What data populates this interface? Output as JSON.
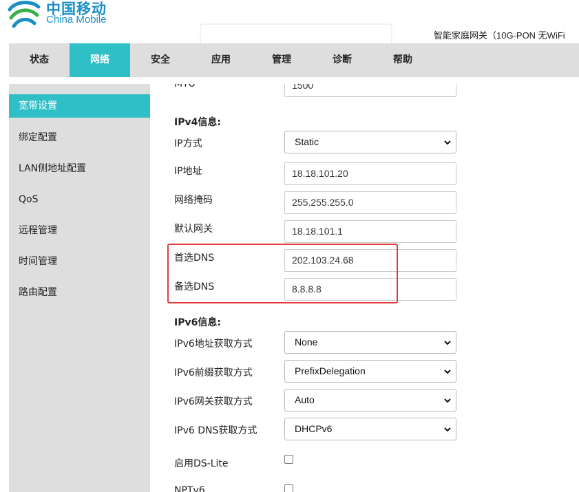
{
  "brand": {
    "name_cn": "中国移动",
    "name_en": "China Mobile",
    "colors": {
      "primary": "#1b8fc5",
      "accent": "#2fbfc6",
      "highlight": "#e53a3a"
    }
  },
  "device_name": "智能家庭网关（10G-PON 无WiFi",
  "topnav": {
    "tabs": [
      {
        "label": "状态",
        "active": false
      },
      {
        "label": "网络",
        "active": true
      },
      {
        "label": "安全",
        "active": false
      },
      {
        "label": "应用",
        "active": false
      },
      {
        "label": "管理",
        "active": false
      },
      {
        "label": "诊断",
        "active": false
      },
      {
        "label": "帮助",
        "active": false
      }
    ]
  },
  "sidebar": {
    "items": [
      {
        "label": "宽带设置",
        "active": true
      },
      {
        "label": "绑定配置",
        "active": false
      },
      {
        "label": "LAN侧地址配置",
        "active": false
      },
      {
        "label": "QoS",
        "active": false
      },
      {
        "label": "远程管理",
        "active": false
      },
      {
        "label": "时间管理",
        "active": false
      },
      {
        "label": "路由配置",
        "active": false
      }
    ]
  },
  "form": {
    "mtu": {
      "label": "MTU",
      "value": "1500"
    },
    "ipv4_section": "IPv4信息:",
    "ip_mode": {
      "label": "IP方式",
      "value": "Static"
    },
    "ip_address": {
      "label": "IP地址",
      "value": "18.18.101.20"
    },
    "netmask": {
      "label": "网络掩码",
      "value": "255.255.255.0"
    },
    "gateway": {
      "label": "默认网关",
      "value": "18.18.101.1"
    },
    "primary_dns": {
      "label": "首选DNS",
      "value": "202.103.24.68"
    },
    "secondary_dns": {
      "label": "备选DNS",
      "value": "8.8.8.8"
    },
    "ipv6_section": "IPv6信息:",
    "ipv6_addr_mode": {
      "label": "IPv6地址获取方式",
      "value": "None"
    },
    "ipv6_prefix_mode": {
      "label": "IPv6前缀获取方式",
      "value": "PrefixDelegation"
    },
    "ipv6_gateway_mode": {
      "label": "IPv6网关获取方式",
      "value": "Auto"
    },
    "ipv6_dns_mode": {
      "label": "IPv6 DNS获取方式",
      "value": "DHCPv6"
    },
    "ds_lite": {
      "label": "启用DS-Lite",
      "checked": false
    },
    "nptv6": {
      "label": "NPTv6",
      "checked": false
    }
  }
}
